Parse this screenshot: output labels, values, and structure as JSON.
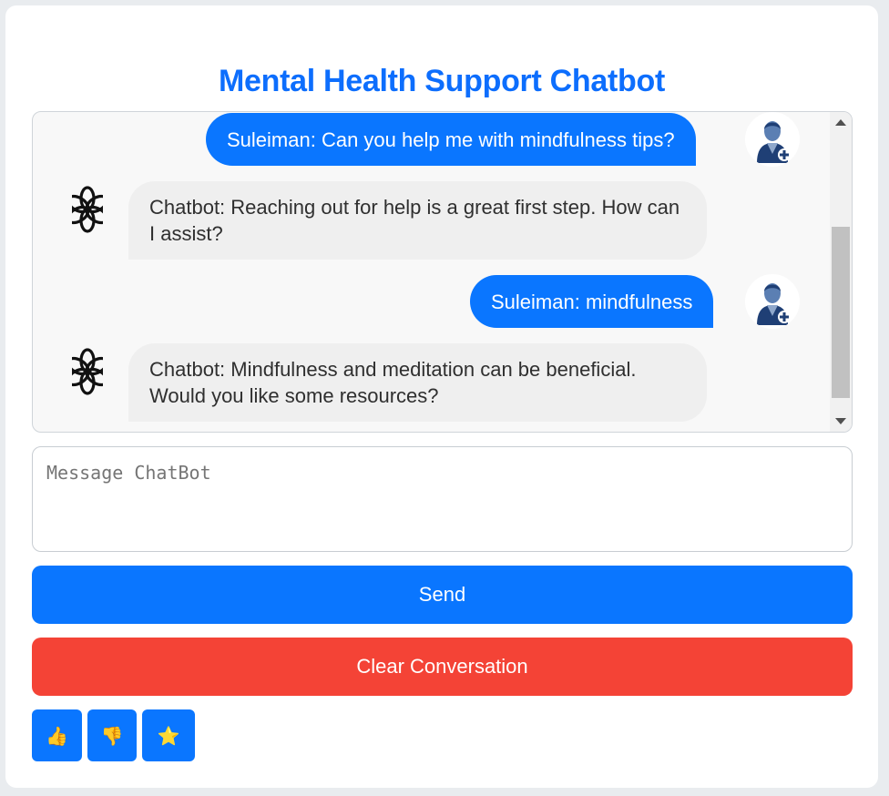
{
  "header": {
    "title": "Mental Health Support Chatbot"
  },
  "messages": [
    {
      "sender": "user",
      "text": "Suleiman: Can you help me with mindfulness tips?",
      "icon": "user-avatar-icon"
    },
    {
      "sender": "bot",
      "text": "Chatbot: Reaching out for help is a great first step. How can I assist?",
      "icon": "chatbot-logo-icon"
    },
    {
      "sender": "user",
      "text": "Suleiman: mindfulness",
      "icon": "user-avatar-icon"
    },
    {
      "sender": "bot",
      "text": "Chatbot: Mindfulness and meditation can be beneficial. Would you like some resources?",
      "icon": "chatbot-logo-icon"
    }
  ],
  "composer": {
    "placeholder": "Message ChatBot",
    "value": ""
  },
  "buttons": {
    "send_label": "Send",
    "clear_label": "Clear Conversation"
  },
  "feedback": {
    "thumbs_up": "👍",
    "thumbs_down": "👎",
    "star": "⭐"
  },
  "colors": {
    "accent": "#0a76ff",
    "danger": "#f44336",
    "title": "#0d6efd"
  }
}
